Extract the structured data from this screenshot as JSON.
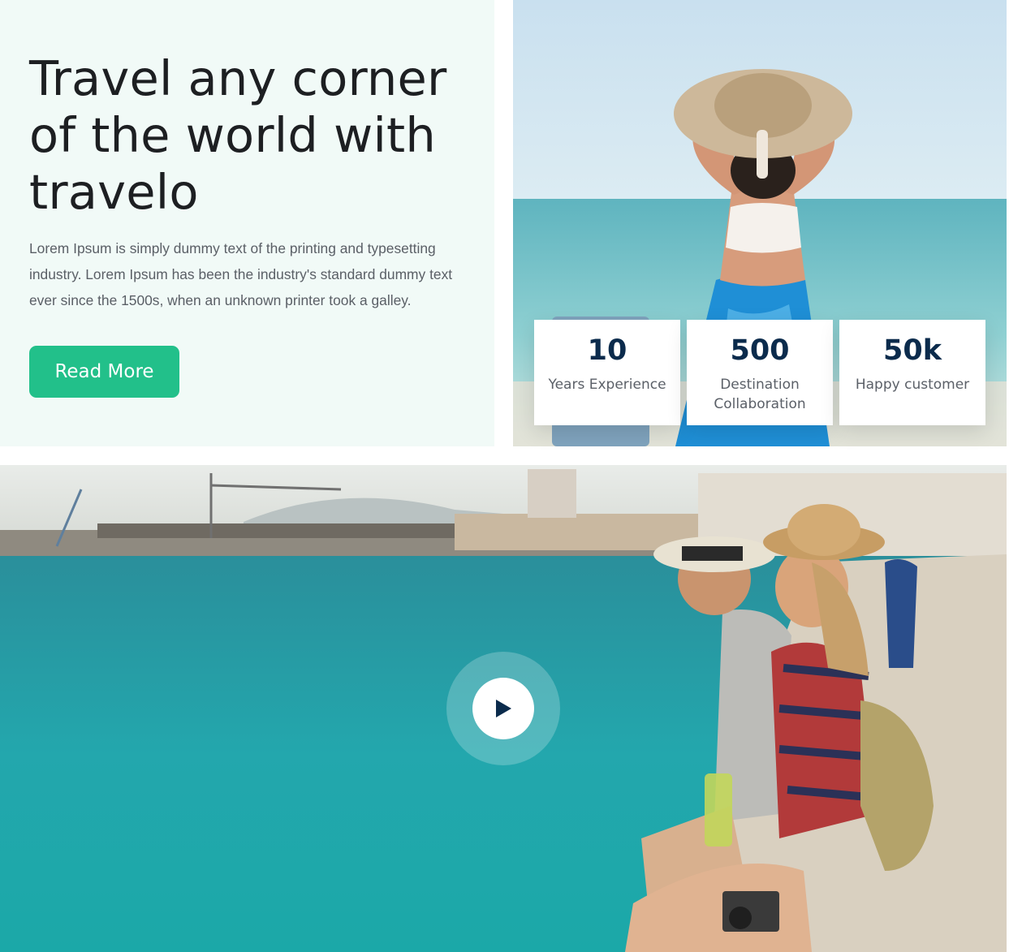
{
  "intro": {
    "title": "Travel any corner of the world with travelo",
    "description": "Lorem Ipsum is simply dummy text of the printing and typesetting industry. Lorem Ipsum has been the industry's standard dummy text ever since the 1500s, when an unknown printer took a galley.",
    "button_label": "Read More"
  },
  "stats": [
    {
      "value": "10",
      "label": "Years Experience"
    },
    {
      "value": "500",
      "label": "Destination Collaboration"
    },
    {
      "value": "50k",
      "label": "Happy customer"
    }
  ],
  "video": {
    "play_icon": "play-icon"
  },
  "colors": {
    "panel_bg": "#f1faf7",
    "accent": "#22c08a",
    "heading": "#1d1f22",
    "stat_number": "#0b2b4c",
    "play_icon": "#0b2b4c"
  }
}
